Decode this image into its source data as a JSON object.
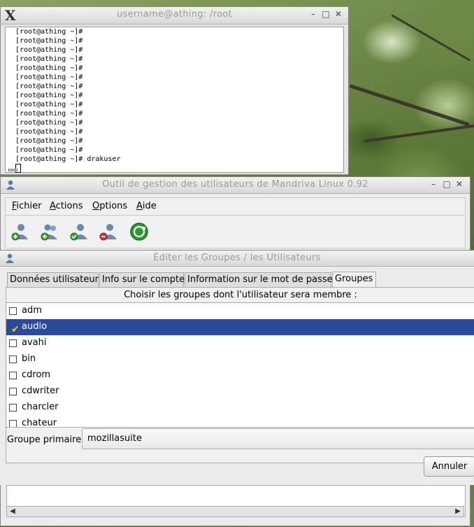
{
  "terminal": {
    "title": "username@athing: /root",
    "prompt_lines": [
      "[root@athing ~]#",
      "[root@athing ~]#",
      "[root@athing ~]#",
      "[root@athing ~]#",
      "[root@athing ~]#",
      "[root@athing ~]#",
      "[root@athing ~]#",
      "[root@athing ~]#",
      "[root@athing ~]#",
      "[root@athing ~]#",
      "[root@athing ~]#",
      "[root@athing ~]#",
      "[root@athing ~]#",
      "[root@athing ~]#",
      "[root@athing ~]# drakuser"
    ]
  },
  "userdrake": {
    "title": "Outil de gestion des utilisateurs de Mandriva Linux 0.92",
    "menu": {
      "fichier_first": "F",
      "fichier_rest": "ichier",
      "actions_first": "A",
      "actions_rest": "ctions",
      "options_first": "O",
      "options_rest": "ptions",
      "aide_first": "A",
      "aide_rest": "ide"
    },
    "toolbar_icons": [
      "add-user-icon",
      "add-group-icon",
      "edit-user-icon",
      "delete-user-icon",
      "refresh-icon"
    ]
  },
  "dialog": {
    "title": "Éditer les Groupes / les Utilisateurs",
    "tabs": {
      "user_data": "Données utilisateur",
      "account_info": "Info sur le compte",
      "password_info": "Information sur le mot de passe",
      "groups": "Groupes"
    },
    "active_tab": "Groupes",
    "groups_heading": "Choisir les groupes dont l'utilisateur sera membre :",
    "groups": [
      {
        "name": "adm",
        "checked": false
      },
      {
        "name": "audio",
        "checked": true
      },
      {
        "name": "avahi",
        "checked": false
      },
      {
        "name": "bin",
        "checked": false
      },
      {
        "name": "cdrom",
        "checked": false
      },
      {
        "name": "cdwriter",
        "checked": false
      },
      {
        "name": "charcler",
        "checked": false
      },
      {
        "name": "chateur",
        "checked": false
      }
    ],
    "primary_group_label": "Groupe primaire",
    "primary_group_value": "mozillasuite",
    "cancel_label": "Annuler"
  },
  "colors": {
    "selection": "#2c4a98",
    "check": "#f0c419"
  }
}
